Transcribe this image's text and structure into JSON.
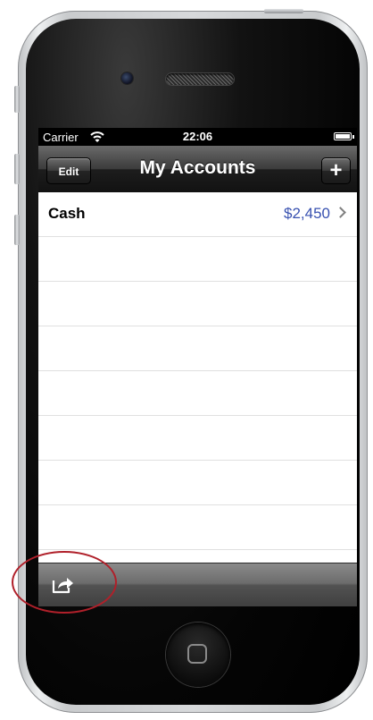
{
  "status_bar": {
    "carrier": "Carrier",
    "time": "22:06"
  },
  "nav_bar": {
    "title": "My Accounts",
    "edit_label": "Edit",
    "add_label": "+"
  },
  "accounts": [
    {
      "name": "Cash",
      "balance": "$2,450"
    }
  ],
  "colors": {
    "balance_text": "#3851b0",
    "annotation": "#b0202a"
  },
  "icons": {
    "wifi": "wifi-icon",
    "battery": "battery-icon",
    "chevron": "chevron-right-icon",
    "action": "share-action-icon"
  }
}
